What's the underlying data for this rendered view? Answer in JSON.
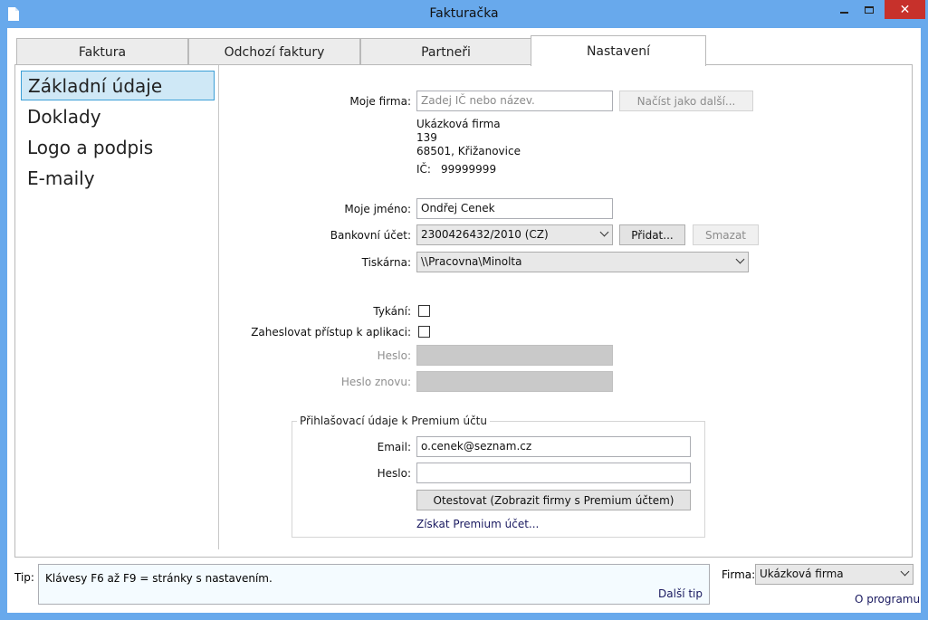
{
  "window": {
    "title": "Fakturačka",
    "close_glyph": "✕"
  },
  "tabs": [
    {
      "label": "Faktura"
    },
    {
      "label": "Odchozí faktury"
    },
    {
      "label": "Partneři"
    },
    {
      "label": "Nastavení"
    }
  ],
  "sidebar": {
    "items": [
      {
        "label": "Základní údaje"
      },
      {
        "label": "Doklady"
      },
      {
        "label": "Logo a podpis"
      },
      {
        "label": "E-maily"
      }
    ]
  },
  "settings": {
    "my_company": {
      "label": "Moje firma:",
      "placeholder": "Zadej IČ nebo název.",
      "load_button": "Načíst jako další...",
      "company_name": "Ukázková firma",
      "street": "139",
      "city": "68501, Křižanovice",
      "ic_label": "IČ:",
      "ic_value": "99999999"
    },
    "my_name": {
      "label": "Moje jméno:",
      "value": "Ondřej Cenek"
    },
    "bank_account": {
      "label": "Bankovní účet:",
      "value": "2300426432/2010 (CZ)",
      "add_button": "Přidat...",
      "delete_button": "Smazat"
    },
    "printer": {
      "label": "Tiskárna:",
      "value": "\\\\Pracovna\\Minolta"
    },
    "tykani": {
      "label": "Tykání:",
      "checked": false
    },
    "password_protect": {
      "label": "Zaheslovat přístup k aplikaci:",
      "checked": false
    },
    "password": {
      "label": "Heslo:"
    },
    "password_again": {
      "label": "Heslo znovu:"
    },
    "premium": {
      "legend": "Přihlašovací údaje k Premium účtu",
      "email_label": "Email:",
      "email_value": "o.cenek@seznam.cz",
      "password_label": "Heslo:",
      "test_button": "Otestovat (Zobrazit firmy s Premium účtem)",
      "get_premium_link": "Získat Premium účet..."
    }
  },
  "footer": {
    "tip_label": "Tip:",
    "tip_text": "Klávesy F6 až F9 = stránky s nastavením.",
    "next_tip": "Další tip",
    "firma_label": "Firma:",
    "firma_value": "Ukázková firma",
    "about_link": "O programu"
  }
}
